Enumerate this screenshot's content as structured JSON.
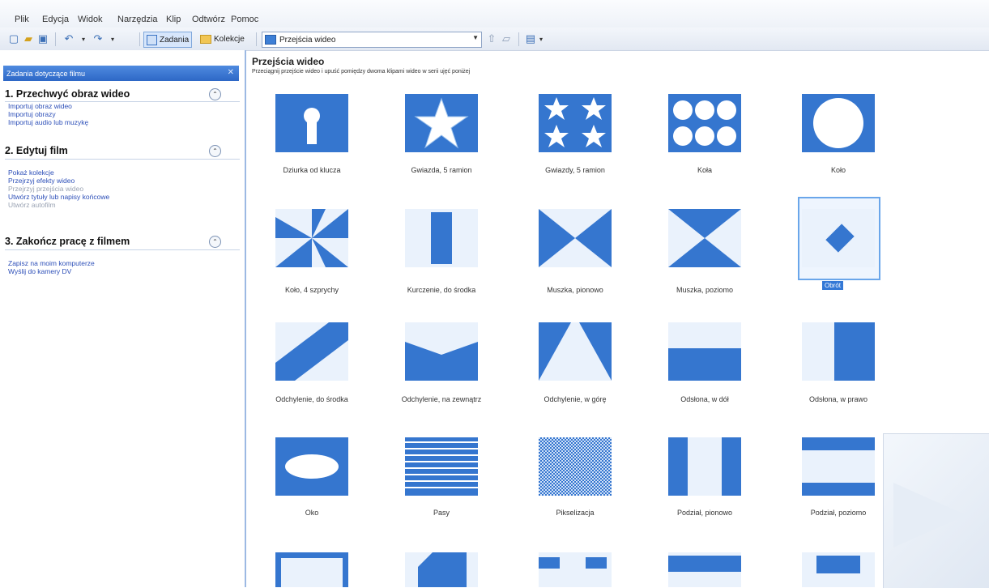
{
  "menu": [
    "Plik",
    "Edycja",
    "Widok",
    "Narzędzia",
    "Klip",
    "Odtwórz",
    "Pomoc"
  ],
  "toolbar": {
    "tasks_label": "Zadania",
    "collections_label": "Kolekcje",
    "combo_value": "Przejścia wideo"
  },
  "sidebar": {
    "header": "Zadania dotyczące filmu",
    "sections": [
      {
        "title": "1. Przechwyć obraz wideo",
        "tasks": [
          "Importuj obraz wideo",
          "Importuj obrazy",
          "Importuj audio lub muzykę"
        ]
      },
      {
        "title": "2. Edytuj film",
        "tasks": [
          "Pokaż kolekcje",
          "Przejrzyj efekty wideo",
          "Przejrzyj przejścia wideo",
          "Utwórz tytuły lub napisy końcowe",
          "Utwórz autofilm"
        ]
      },
      {
        "title": "3. Zakończ pracę z filmem",
        "tasks": [
          "Zapisz na moim komputerze",
          "Wyślij do kamery DV"
        ]
      }
    ]
  },
  "main": {
    "title": "Przejścia wideo",
    "subtitle": "Przeciągnij przejście wideo i upuść pomiędzy dwoma klipami wideo w serii ujęć poniżej",
    "transitions": [
      "Dziurka od klucza",
      "Gwiazda, 5 ramion",
      "Gwiazdy, 5 ramion",
      "Koła",
      "Koło",
      "Koło, 4 szprychy",
      "Kurczenie, do środka",
      "Muszka, pionowo",
      "Muszka, poziomo",
      "Obrót",
      "Odchylenie, do środka",
      "Odchylenie, na zewnątrz",
      "Odchylenie, w górę",
      "Odsłona, w dół",
      "Odsłona, w prawo",
      "Oko",
      "Pasy",
      "Pikselizacja",
      "Podział, pionowo",
      "Podział, poziomo"
    ],
    "selected_transition": "Obrót"
  },
  "colors": {
    "accent": "#3576cf",
    "header": "#2d67c6"
  }
}
